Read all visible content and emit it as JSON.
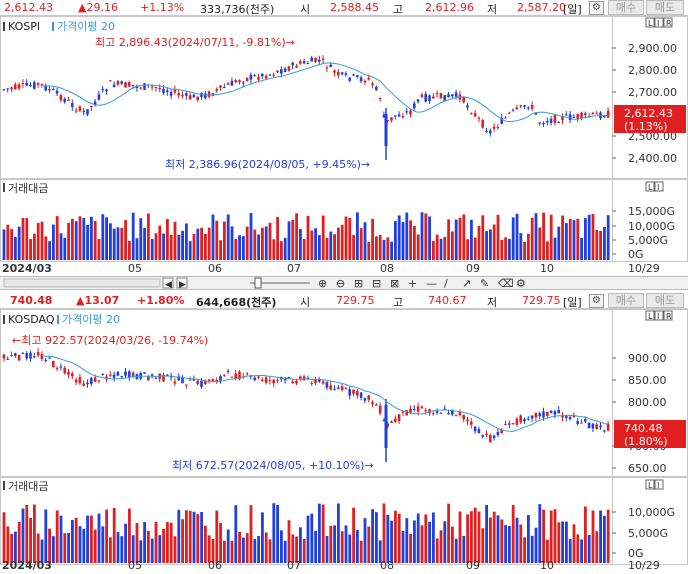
{
  "kospi": {
    "summary": {
      "price": "2,612.43",
      "change": "▲29.16",
      "change_pct": "+1.13%",
      "volume": "333,736(천주)",
      "open_label": "시",
      "open": "2,588.45",
      "high_label": "고",
      "high": "2,612.96",
      "low_label": "저",
      "low": "2,587.20",
      "period": "[일]",
      "buy_label": "매수",
      "sell_label": "매도"
    },
    "name": "KOSPI",
    "ma_label": "가격이평 20",
    "max_annot": "최고 2,896.43(2024/07/11, -9.81%)→",
    "min_annot": "최저 2,386.96(2024/08/05, +9.45%)→",
    "price_ticks": [
      "2,900.00",
      "2,800.00",
      "2,700.00",
      "2,500.00",
      "2,400.00"
    ],
    "last_price_tag": "2,612.43",
    "last_pct_tag": "(1.13%)",
    "volume_label": "거래대금",
    "volume_ticks": [
      "15,000G",
      "10,000G",
      "5,000G",
      "0G"
    ],
    "x_labels": [
      "2024/03",
      "05",
      "06",
      "07",
      "08",
      "09",
      "10",
      "10/29"
    ]
  },
  "kosdaq": {
    "summary": {
      "price": "740.48",
      "change": "▲13.07",
      "change_pct": "+1.80%",
      "volume": "644,668(천주)",
      "open_label": "시",
      "open": "729.75",
      "high_label": "고",
      "high": "740.67",
      "low_label": "저",
      "low": "729.75",
      "period": "[일]",
      "buy_label": "매수",
      "sell_label": "매도"
    },
    "name": "KOSDAQ",
    "ma_label": "가격이평 20",
    "max_annot": "←최고 922.57(2024/03/26, -19.74%)",
    "min_annot": "최저 672.57(2024/08/05, +10.10%)→",
    "price_ticks": [
      "900.00",
      "850.00",
      "800.00",
      "700.00",
      "650.00"
    ],
    "last_price_tag": "740.48",
    "last_pct_tag": "(1.80%)",
    "volume_label": "거래대금",
    "volume_ticks": [
      "10,000G",
      "5,000G",
      "0G"
    ],
    "x_labels": [
      "2024/03",
      "05",
      "06",
      "07",
      "08",
      "09",
      "10",
      "10/29"
    ]
  },
  "colors": {
    "up": "#e02020",
    "down": "#1f3fe0",
    "ma": "#3a9ad9",
    "tag_bg": "#e02020"
  },
  "toolbar_icons": [
    "scroll-left-icon",
    "scroll-right-icon",
    "zoom-slider-icon",
    "zoom-in-icon",
    "zoom-out-icon",
    "crosshair-icon",
    "hline-icon",
    "diagonal-line-icon",
    "trend-tool-icon",
    "pen-icon",
    "eraser-icon",
    "settings-icon"
  ]
}
